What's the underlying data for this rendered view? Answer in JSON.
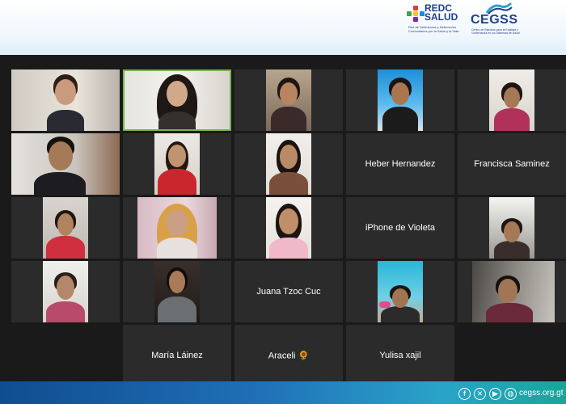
{
  "header": {
    "redc_logo": {
      "line1": "REDC",
      "line2": "SALUD",
      "subtitle": "Red de Defensoras y Defensores Comunitarios por la Salud y la Vida"
    },
    "cegss_logo": {
      "name": "CEGSS",
      "subtitle": "Centro de Estudios para la Equidad y Gobernanza en los Sistemas de Salud"
    }
  },
  "meeting": {
    "participants": [
      {
        "id": "p1",
        "video": true
      },
      {
        "id": "p2",
        "video": true,
        "speaking": true
      },
      {
        "id": "p3",
        "video": true
      },
      {
        "id": "p4",
        "video": true
      },
      {
        "id": "p5",
        "video": true
      },
      {
        "id": "p6",
        "video": true
      },
      {
        "id": "p7",
        "video": true
      },
      {
        "id": "p8",
        "video": true
      },
      {
        "id": "p9",
        "name": "Heber Hernandez",
        "video": false
      },
      {
        "id": "p10",
        "name": "Francisca Saminez",
        "video": false
      },
      {
        "id": "p11",
        "video": true
      },
      {
        "id": "p12",
        "video": true
      },
      {
        "id": "p13",
        "video": true
      },
      {
        "id": "p14",
        "name": "iPhone de Violeta",
        "video": false
      },
      {
        "id": "p15",
        "video": true
      },
      {
        "id": "p16",
        "video": true
      },
      {
        "id": "p17",
        "video": true
      },
      {
        "id": "p18",
        "name": "Juana Tzoc Cuc",
        "video": false
      },
      {
        "id": "p19",
        "video": true
      },
      {
        "id": "p20",
        "video": true
      },
      {
        "id": "p21",
        "name": "María Láinez",
        "video": false
      },
      {
        "id": "p22",
        "name": "Araceli 🌻",
        "video": false
      },
      {
        "id": "p23",
        "name": "Yulisa xajil",
        "video": false
      }
    ]
  },
  "footer": {
    "icons": [
      "facebook-icon",
      "x-icon",
      "youtube-icon",
      "globe-icon"
    ],
    "website": "cegss.org.gt"
  },
  "colors": {
    "speaking_border": "#76b34f",
    "tile_background": "#2b2b2b",
    "grid_background": "#1a1a1a",
    "brand_blue": "#1f3f8f"
  }
}
